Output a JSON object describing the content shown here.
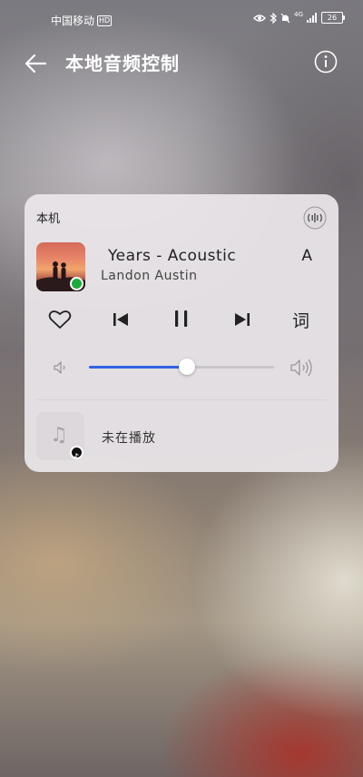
{
  "status_bar": {
    "carrier": "中国移动",
    "hd_badge": "HD",
    "network": "4G",
    "battery": "26"
  },
  "header": {
    "title": "本地音频控制"
  },
  "player": {
    "device_label": "本机",
    "song_title": "Years - Acoustic",
    "song_title_extra": "A",
    "artist": "Landon Austin",
    "lyrics_button": "词",
    "volume_level": 0.53,
    "accent_color": "#2f63e6"
  },
  "secondary_session": {
    "status": "未在播放"
  },
  "icons": {
    "back": "back-arrow-icon",
    "info": "info-icon",
    "cast": "audio-output-icon",
    "like": "heart-icon",
    "prev": "skip-previous-icon",
    "pause": "pause-icon",
    "next": "skip-next-icon",
    "volume_low": "volume-low-icon",
    "volume_high": "volume-high-icon",
    "music_note": "music-note-icon"
  }
}
